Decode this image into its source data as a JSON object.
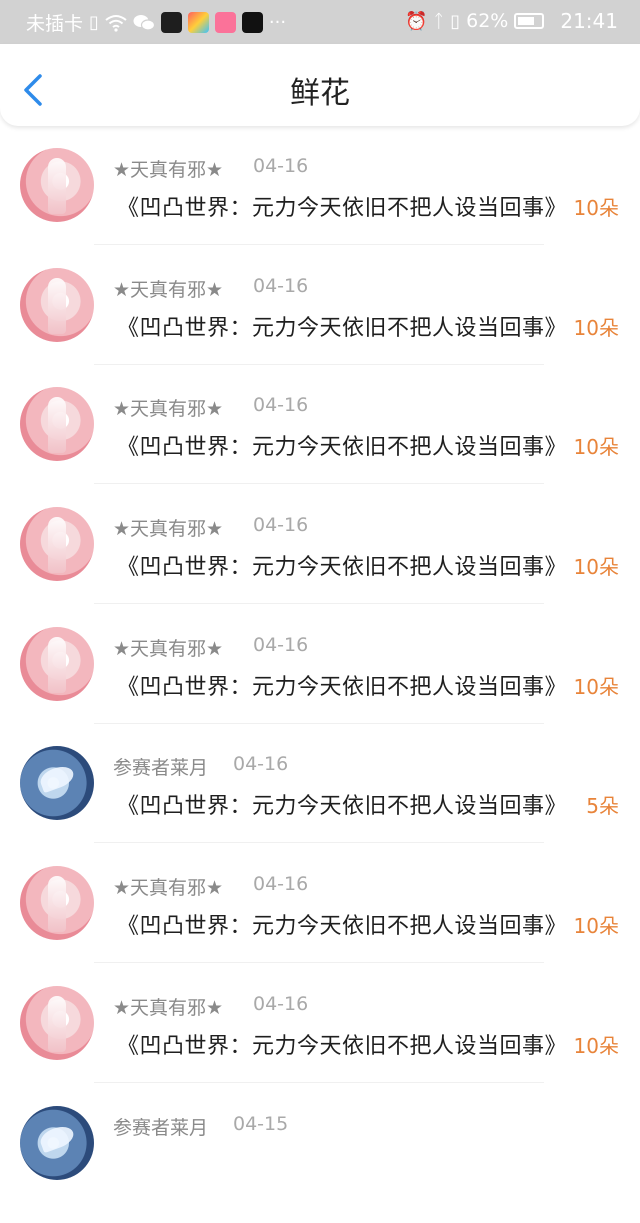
{
  "status_bar": {
    "carrier": "未插卡",
    "more": "···",
    "battery": "62%",
    "time": "21:41"
  },
  "header": {
    "title": "鲜花"
  },
  "colors": {
    "accent_blue": "#2e8bea",
    "amount_orange": "#e8843a",
    "username_gray": "#8a8a8a"
  },
  "list": [
    {
      "username": "★天真有邪★",
      "date": "04-16",
      "message": "《凹凸世界：元力今天依旧不把人设当回事》",
      "amount": "10朵",
      "avatar": "pink-avatar"
    },
    {
      "username": "★天真有邪★",
      "date": "04-16",
      "message": "《凹凸世界：元力今天依旧不把人设当回事》",
      "amount": "10朵",
      "avatar": "pink-avatar"
    },
    {
      "username": "★天真有邪★",
      "date": "04-16",
      "message": "《凹凸世界：元力今天依旧不把人设当回事》",
      "amount": "10朵",
      "avatar": "pink-avatar"
    },
    {
      "username": "★天真有邪★",
      "date": "04-16",
      "message": "《凹凸世界：元力今天依旧不把人设当回事》",
      "amount": "10朵",
      "avatar": "pink-avatar"
    },
    {
      "username": "★天真有邪★",
      "date": "04-16",
      "message": "《凹凸世界：元力今天依旧不把人设当回事》",
      "amount": "10朵",
      "avatar": "pink-avatar"
    },
    {
      "username": "参赛者莱月",
      "date": "04-16",
      "message": "《凹凸世界：元力今天依旧不把人设当回事》",
      "amount": "5朵",
      "avatar": "blue-avatar"
    },
    {
      "username": "★天真有邪★",
      "date": "04-16",
      "message": "《凹凸世界：元力今天依旧不把人设当回事》",
      "amount": "10朵",
      "avatar": "pink-avatar"
    },
    {
      "username": "★天真有邪★",
      "date": "04-16",
      "message": "《凹凸世界：元力今天依旧不把人设当回事》",
      "amount": "10朵",
      "avatar": "pink-avatar"
    },
    {
      "username": "参赛者莱月",
      "date": "04-15",
      "message": "",
      "amount": "",
      "avatar": "blue-avatar"
    }
  ]
}
